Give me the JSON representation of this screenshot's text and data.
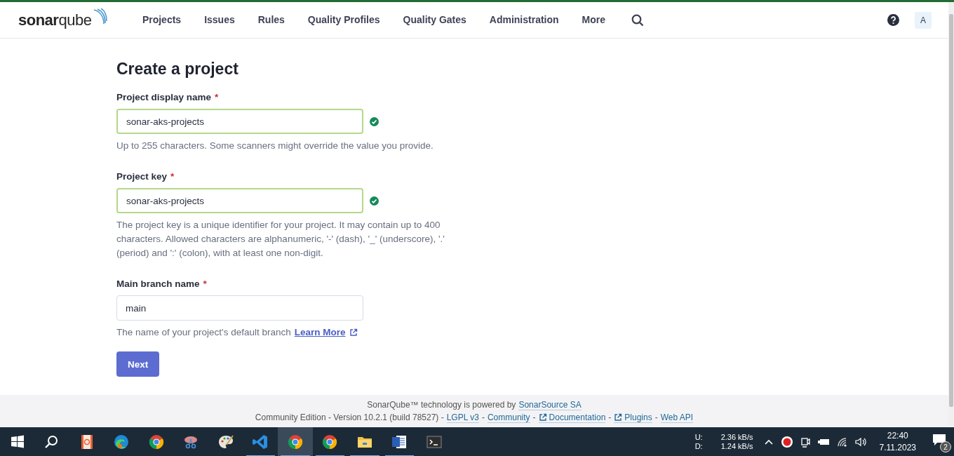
{
  "header": {
    "logo": "**sonar**qube",
    "nav": [
      {
        "label": "Projects",
        "selected": false
      },
      {
        "label": "Issues",
        "selected": false
      },
      {
        "label": "Rules",
        "selected": false
      },
      {
        "label": "Quality Profiles",
        "selected": false
      },
      {
        "label": "Quality Gates",
        "selected": false
      },
      {
        "label": "Administration",
        "selected": false
      },
      {
        "label": "More",
        "selected": false
      }
    ],
    "avatar": "A"
  },
  "form": {
    "title": "Create a project",
    "fields": [
      {
        "label": "Project display name",
        "required_mark": "*",
        "value": "sonar-aks-projects",
        "valid": true,
        "hint": "Up to 255 characters. Some scanners might override the value you provide."
      },
      {
        "label": "Project key",
        "required_mark": "*",
        "value": "sonar-aks-projects",
        "valid": true,
        "hint": "The project key is a unique identifier for your project. It may contain up to 400 characters. Allowed characters are alphanumeric, '-' (dash), '_' (underscore), '.' (period) and ':' (colon), with at least one non-digit."
      },
      {
        "label": "Main branch name",
        "required_mark": "*",
        "value": "main",
        "valid": false,
        "hint": "The name of your project's default branch",
        "hint_link": "Learn More"
      }
    ],
    "submit": "Next"
  },
  "footer": {
    "line_1": [
      {
        "kind": "text",
        "text": "SonarQube™ technology is powered by"
      },
      {
        "kind": "link",
        "text": "SonarSource SA",
        "external": false
      }
    ],
    "line_2": [
      {
        "kind": "text",
        "text": "Community Edition - Version 10.2.1 (build 78527) -"
      },
      {
        "kind": "link",
        "text": "LGPL v3",
        "external": false
      },
      {
        "kind": "text",
        "text": "-"
      },
      {
        "kind": "link",
        "text": "Community",
        "external": false
      },
      {
        "kind": "text",
        "text": "-"
      },
      {
        "kind": "link",
        "text": "Documentation",
        "external": true
      },
      {
        "kind": "text",
        "text": "-"
      },
      {
        "kind": "link",
        "text": "Plugins",
        "external": true
      },
      {
        "kind": "text",
        "text": "-"
      },
      {
        "kind": "link",
        "text": "Web API",
        "external": false
      }
    ]
  },
  "taskbar": {
    "apps": [
      {
        "kind": "start",
        "running": false,
        "selected": false
      },
      {
        "kind": "search",
        "running": false,
        "selected": false
      },
      {
        "kind": "document",
        "running": false,
        "selected": false
      },
      {
        "kind": "edge",
        "running": false,
        "selected": false
      },
      {
        "kind": "chrome",
        "running": false,
        "selected": false
      },
      {
        "kind": "scissors",
        "running": false,
        "selected": false
      },
      {
        "kind": "palette",
        "running": false,
        "selected": false
      },
      {
        "kind": "code",
        "running": true,
        "selected": false
      },
      {
        "kind": "chrome",
        "running": true,
        "selected": true
      },
      {
        "kind": "chrome",
        "running": true,
        "selected": false
      },
      {
        "kind": "folder",
        "running": true,
        "selected": false
      },
      {
        "kind": "word",
        "running": true,
        "selected": false
      },
      {
        "kind": "terminal",
        "running": false,
        "selected": false
      }
    ],
    "net_labels": [
      "U:",
      "D:"
    ],
    "net_rates": [
      "2.36 kB/s",
      "1.24 kB/s"
    ],
    "time": "22:40",
    "date": "7.11.2023",
    "notifications": "2"
  }
}
